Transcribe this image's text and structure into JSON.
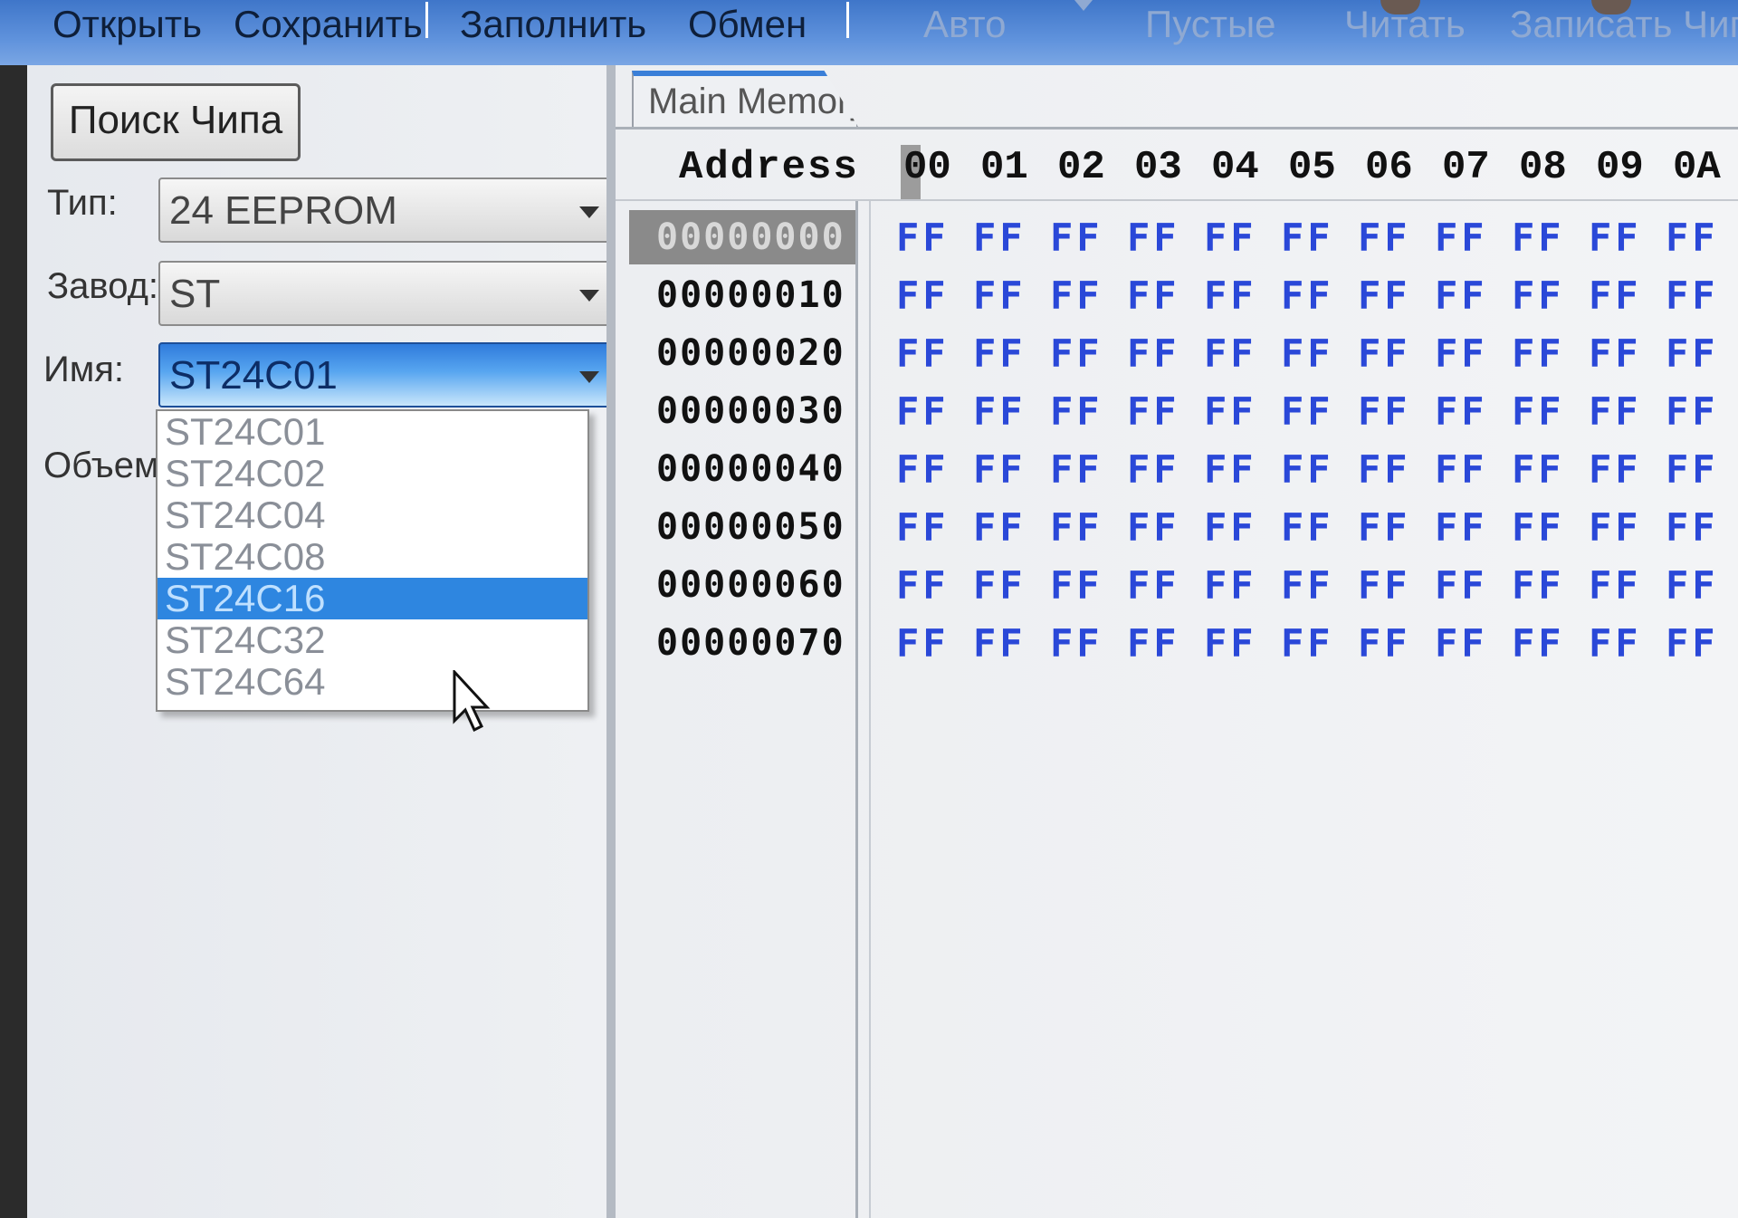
{
  "toolbar": {
    "open": "Открыть",
    "save": "Сохранить",
    "fill": "Заполнить",
    "exchange": "Обмен",
    "auto": "Авто",
    "blank": "Пустые",
    "read": "Читать",
    "write": "Записать Чип"
  },
  "left": {
    "search_button": "Поиск Чипа",
    "type_label": "Тип:",
    "type_value": "24 EEPROM",
    "maker_label": "Завод:",
    "maker_value": "ST",
    "name_label": "Имя:",
    "name_value": "ST24C01",
    "volume_label": "Объем",
    "dropdown": [
      "ST24C01",
      "ST24C02",
      "ST24C04",
      "ST24C08",
      "ST24C16",
      "ST24C32",
      "ST24C64"
    ],
    "dropdown_selected": "ST24C16"
  },
  "memory": {
    "tab": "Main Memory",
    "address_header": "Address",
    "columns": [
      "00",
      "01",
      "02",
      "03",
      "04",
      "05",
      "06",
      "07",
      "08",
      "09",
      "0A"
    ],
    "rows": [
      {
        "addr": "00000000",
        "cells": [
          "FF",
          "FF",
          "FF",
          "FF",
          "FF",
          "FF",
          "FF",
          "FF",
          "FF",
          "FF",
          "FF"
        ]
      },
      {
        "addr": "00000010",
        "cells": [
          "FF",
          "FF",
          "FF",
          "FF",
          "FF",
          "FF",
          "FF",
          "FF",
          "FF",
          "FF",
          "FF"
        ]
      },
      {
        "addr": "00000020",
        "cells": [
          "FF",
          "FF",
          "FF",
          "FF",
          "FF",
          "FF",
          "FF",
          "FF",
          "FF",
          "FF",
          "FF"
        ]
      },
      {
        "addr": "00000030",
        "cells": [
          "FF",
          "FF",
          "FF",
          "FF",
          "FF",
          "FF",
          "FF",
          "FF",
          "FF",
          "FF",
          "FF"
        ]
      },
      {
        "addr": "00000040",
        "cells": [
          "FF",
          "FF",
          "FF",
          "FF",
          "FF",
          "FF",
          "FF",
          "FF",
          "FF",
          "FF",
          "FF"
        ]
      },
      {
        "addr": "00000050",
        "cells": [
          "FF",
          "FF",
          "FF",
          "FF",
          "FF",
          "FF",
          "FF",
          "FF",
          "FF",
          "FF",
          "FF"
        ]
      },
      {
        "addr": "00000060",
        "cells": [
          "FF",
          "FF",
          "FF",
          "FF",
          "FF",
          "FF",
          "FF",
          "FF",
          "FF",
          "FF",
          "FF"
        ]
      },
      {
        "addr": "00000070",
        "cells": [
          "FF",
          "FF",
          "FF",
          "FF",
          "FF",
          "FF",
          "FF",
          "FF",
          "FF",
          "FF",
          "FF"
        ]
      }
    ],
    "selected_row": "00000000"
  }
}
